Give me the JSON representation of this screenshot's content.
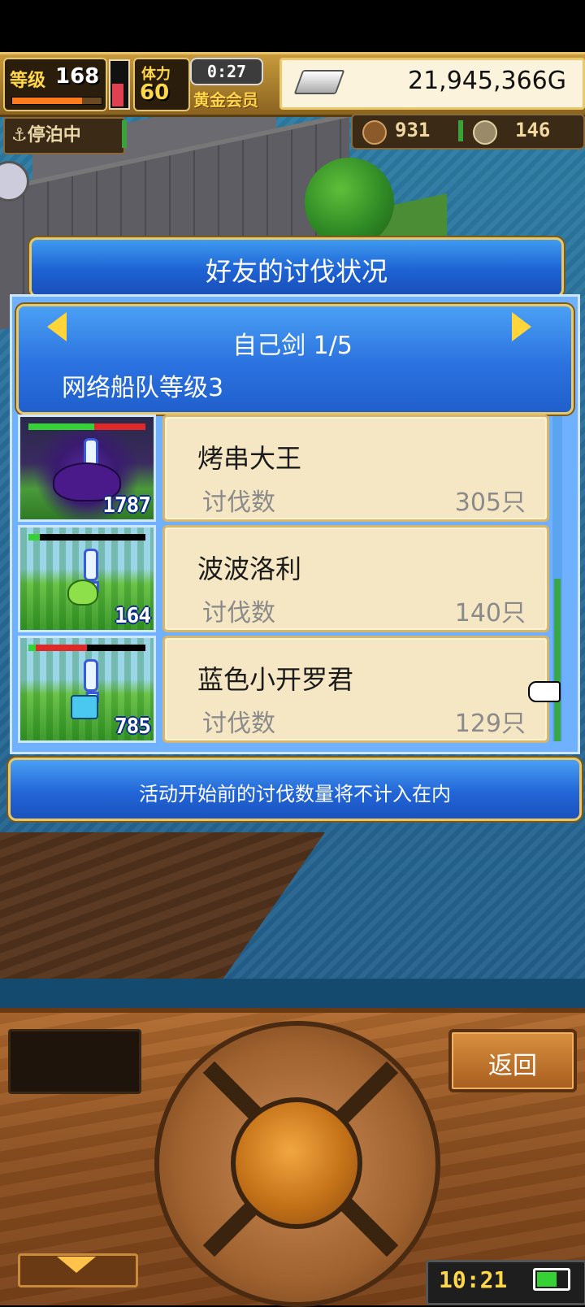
{
  "hud": {
    "level_label": "等级",
    "level_value": "168",
    "stamina_label": "体力",
    "stamina_value": "60",
    "timer": "0:27",
    "membership": "黄金会员",
    "gold": "21,945,366G",
    "status": "⚓停泊中",
    "resource1_value": "931",
    "resource2_value": "146"
  },
  "dialog": {
    "title": "好友的讨伐状况",
    "monster_name": "自己剑 1/5",
    "fleet_level": "网络船队等级3",
    "rows": [
      {
        "name": "烤串大王",
        "label": "讨伐数",
        "value": "305只",
        "thumb_count": "1787"
      },
      {
        "name": "波波洛利",
        "label": "讨伐数",
        "value": "140只",
        "thumb_count": "164"
      },
      {
        "name": "蓝色小开罗君",
        "label": "讨伐数",
        "value": "129只",
        "thumb_count": "785"
      }
    ],
    "notice": "活动开始前的讨伐数量将不计入在内"
  },
  "console": {
    "back_label": "返回",
    "clock": "10:21"
  },
  "colors": {
    "banner_blue": "#2b72e0",
    "card_bg": "#f6e7c4",
    "gold_border": "#e8c868"
  }
}
